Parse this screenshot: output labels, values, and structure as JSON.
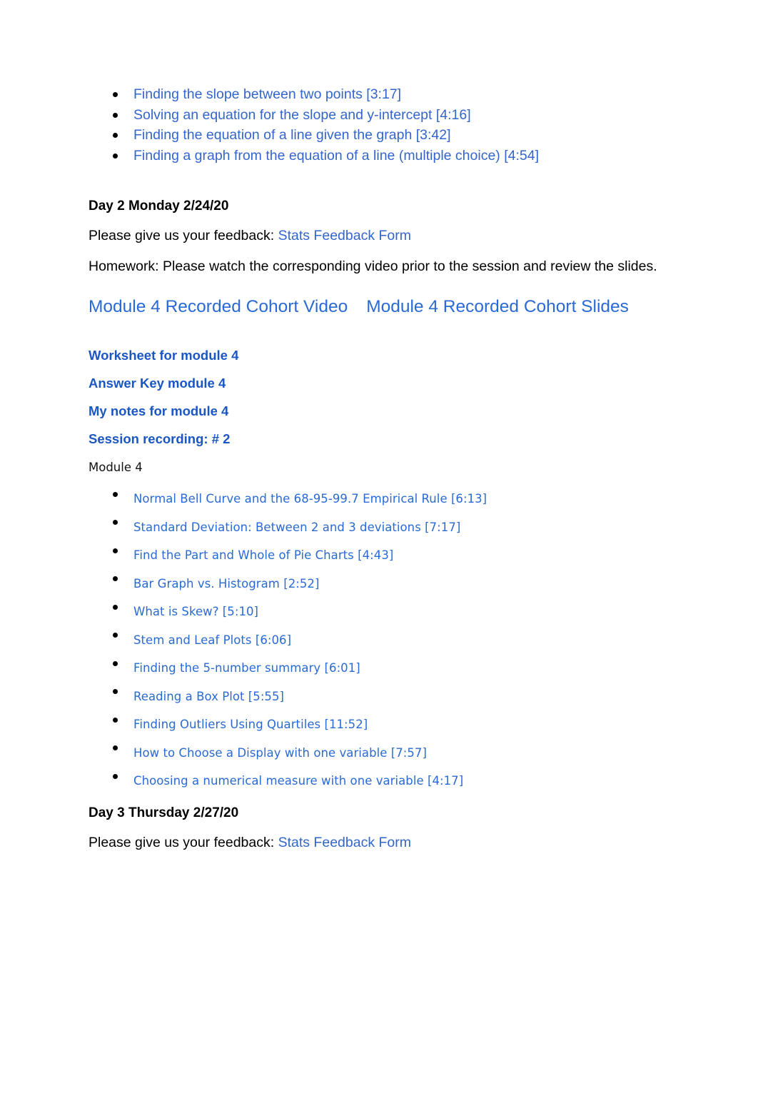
{
  "document": {
    "colors": {
      "link_blue": "#3366cc",
      "heading_link_blue": "#2a6ad4",
      "bold_link_blue": "#1a56c4",
      "body_text": "#000000",
      "page_background": "#ffffff"
    }
  },
  "top_video_list": [
    {
      "label": "Finding the slope between two points [3:17]"
    },
    {
      "label": "Solving an equation for the slope and y-intercept [4:16]"
    },
    {
      "label": "Finding the equation of a line given the graph [3:42]"
    },
    {
      "label": "Finding a graph from the equation of a line (multiple choice) [4:54]"
    }
  ],
  "day2": {
    "heading": "Day 2 Monday 2/24/20",
    "feedback_prefix": "Please give us your feedback: ",
    "feedback_link": "Stats Feedback Form",
    "homework": "Homework: Please watch the corresponding video prior to the session and review the slides.",
    "resource_headings": {
      "video": "Module 4 Recorded Cohort Video",
      "slides": "Module 4 Recorded Cohort Slides"
    },
    "resource_links": [
      {
        "label": "Worksheet for module 4"
      },
      {
        "label": "Answer Key module 4"
      },
      {
        "label": "My notes for module 4"
      },
      {
        "label": "Session recording: # 2"
      }
    ],
    "module_label": "Module 4",
    "module_video_list": [
      {
        "label": "Normal Bell Curve and the 68-95-99.7 Empirical Rule [6:13]"
      },
      {
        "label": "Standard Deviation: Between 2 and 3 deviations [7:17]"
      },
      {
        "label": "Find the Part and Whole of Pie Charts [4:43]"
      },
      {
        "label": "Bar Graph vs. Histogram [2:52]"
      },
      {
        "label": "What is Skew? [5:10]"
      },
      {
        "label": "Stem and Leaf Plots [6:06]"
      },
      {
        "label": "Finding the 5-number summary [6:01]"
      },
      {
        "label": "Reading a Box Plot [5:55]"
      },
      {
        "label": "Finding Outliers Using Quartiles [11:52]"
      },
      {
        "label": "How to Choose a Display with one variable [7:57]"
      },
      {
        "label": "Choosing a numerical measure with one variable [4:17]"
      }
    ]
  },
  "day3": {
    "heading": "Day 3 Thursday 2/27/20",
    "feedback_prefix": "Please give us your feedback: ",
    "feedback_link": "Stats Feedback Form"
  }
}
